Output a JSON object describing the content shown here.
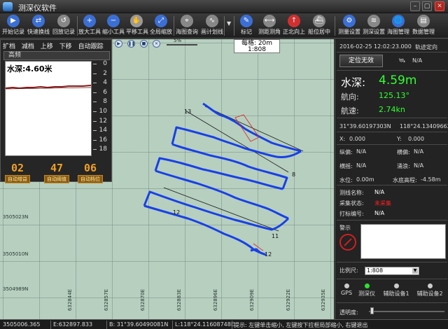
{
  "window": {
    "title": "测深仪软件"
  },
  "toolbar": {
    "items": [
      {
        "label": "开始记录",
        "icon": "play-icon",
        "color": "#3b6fd4"
      },
      {
        "label": "快速换线",
        "icon": "switch-line-icon",
        "color": "#3b6fd4"
      },
      {
        "label": "回放记录",
        "icon": "replay-icon",
        "color": "#888888"
      },
      {
        "label": "放大工具",
        "icon": "zoom-in-icon",
        "color": "#3b6fd4"
      },
      {
        "label": "缩小工具",
        "icon": "zoom-out-icon",
        "color": "#3b6fd4"
      },
      {
        "label": "平移工具",
        "icon": "hand-icon",
        "color": "#999999"
      },
      {
        "label": "全局缩放",
        "icon": "fit-icon",
        "color": "#3b6fd4"
      },
      {
        "label": "海图查询",
        "icon": "query-icon",
        "color": "#888888"
      },
      {
        "label": "画计划线",
        "icon": "plan-line-icon",
        "color": "#888888"
      },
      {
        "label": "标记",
        "icon": "pin-icon",
        "color": "#3b6fd4"
      },
      {
        "label": "测距测角",
        "icon": "ruler-icon",
        "color": "#888888"
      },
      {
        "label": "正北向上",
        "icon": "north-up-icon",
        "color": "#d03030"
      },
      {
        "label": "船位居中",
        "icon": "ship-center-icon",
        "color": "#888888"
      },
      {
        "label": "测量设置",
        "icon": "gear-icon",
        "color": "#3b6fd4"
      },
      {
        "label": "测深设置",
        "icon": "sounder-settings-icon",
        "color": "#888888"
      },
      {
        "label": "海图管理",
        "icon": "chart-manage-icon",
        "color": "#3b6fd4"
      },
      {
        "label": "数据管理",
        "icon": "database-icon",
        "color": "#888888"
      }
    ]
  },
  "depth_panel": {
    "tabs": [
      "扩档",
      "减档",
      "上移",
      "下移",
      "自动跟踪"
    ],
    "title": "高频",
    "depth_label": "水深:4.60米",
    "scale_ticks": [
      "0",
      "2",
      "4",
      "6",
      "8",
      "10",
      "12",
      "14",
      "16",
      "18"
    ],
    "controls": [
      {
        "value": "02",
        "label": "自动增益"
      },
      {
        "value": "47",
        "label": "自动阈值"
      },
      {
        "value": "06",
        "label": "自动档位"
      }
    ]
  },
  "player": {
    "percent": "5%"
  },
  "map": {
    "scale_title": "每格: 20m",
    "scale_ratio": "1:808",
    "y_ticks": [
      "3505023N",
      "3505010N",
      "3504989N"
    ],
    "x_ticks": [
      "632844E",
      "632857E",
      "632870E",
      "632883E",
      "632896E",
      "632909E",
      "632922E",
      "632935E",
      "632948E"
    ],
    "line_labels": [
      "13",
      "8",
      "12",
      "11",
      "12"
    ]
  },
  "right_panel": {
    "datetime": "2016-02-25 12:02:23.000",
    "mode": "轨迹定向",
    "fix_button": "定位无效",
    "na": "N/A",
    "depth_label": "水深:",
    "depth_value": "4.59m",
    "heading_label": "航向:",
    "heading_value": "125.13°",
    "speed_label": "航速:",
    "speed_value": "2.74kn",
    "lat": "31°39.60197303N",
    "lon": "118°24.13409662E",
    "x_label": "X:",
    "x_value": "0.000",
    "y_label": "Y:",
    "y_value": "0.000",
    "lon_dev_label": "纵偏:",
    "lon_dev_value": "N/A",
    "lat_dev_label": "横偏:",
    "lat_dev_value": "N/A",
    "heave_label": "横摇:",
    "heave_value": "N/A",
    "comp_label": "涌浪:",
    "comp_value": "N/A",
    "tide_label": "水位:",
    "tide_value": "0.00m",
    "bottom_label": "水底高程:",
    "bottom_value": "-4.58m",
    "line_name_label": "测线名称:",
    "line_name_value": "N/A",
    "collect_label": "采集状态:",
    "collect_value": "未采集",
    "mark_label": "打标编号:",
    "mark_value": "N/A",
    "alarm_label": "警示",
    "scale_label": "比例尺:",
    "scale_value": "1:808",
    "devices": [
      {
        "label": "GPS",
        "on": false
      },
      {
        "label": "测深仪",
        "on": true
      },
      {
        "label": "辅助设备1",
        "on": false
      },
      {
        "label": "辅助设备2",
        "on": false
      }
    ],
    "transparency_label": "透明度:"
  },
  "status": {
    "coord_x": "3505006.365",
    "coord_e": "E:632897.833",
    "lat": "B: 31°39.60490081N",
    "lon": "L:118°24.11608748E",
    "hint": "提示: 左键单击缩小, 左键按下拉框局部缩小, 右键退出"
  }
}
